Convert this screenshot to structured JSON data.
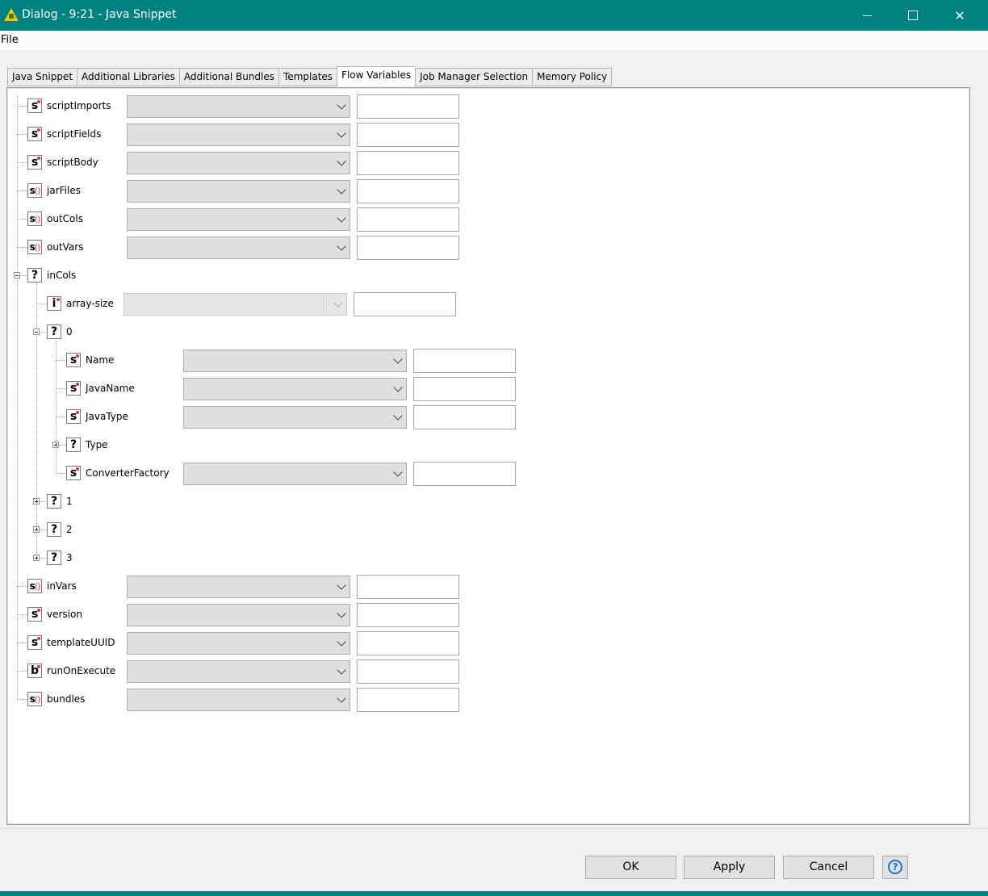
{
  "window": {
    "title": "Dialog - 9:21 - Java Snippet"
  },
  "menu": {
    "file": "File"
  },
  "tabs": [
    {
      "label": "Java Snippet",
      "active": false
    },
    {
      "label": "Additional Libraries",
      "active": false
    },
    {
      "label": "Additional Bundles",
      "active": false
    },
    {
      "label": "Templates",
      "active": false
    },
    {
      "label": "Flow Variables",
      "active": true
    },
    {
      "label": "Job Manager Selection",
      "active": false
    },
    {
      "label": "Memory Policy",
      "active": false
    }
  ],
  "tree": [
    {
      "label": "scriptImports",
      "type": "s",
      "icon": "string-icon"
    },
    {
      "label": "scriptFields",
      "type": "s",
      "icon": "string-icon"
    },
    {
      "label": "scriptBody",
      "type": "s",
      "icon": "string-icon"
    },
    {
      "label": "jarFiles",
      "type": "s()",
      "icon": "string-array-icon"
    },
    {
      "label": "outCols",
      "type": "s()",
      "icon": "string-array-icon"
    },
    {
      "label": "outVars",
      "type": "s()",
      "icon": "string-array-icon"
    },
    {
      "label": "inCols",
      "type": "?",
      "icon": "unknown-type-icon"
    },
    {
      "label": "array-size",
      "type": "i",
      "icon": "integer-icon"
    },
    {
      "label": "0",
      "type": "?",
      "icon": "unknown-type-icon"
    },
    {
      "label": "Name",
      "type": "s",
      "icon": "string-icon"
    },
    {
      "label": "JavaName",
      "type": "s",
      "icon": "string-icon"
    },
    {
      "label": "JavaType",
      "type": "s",
      "icon": "string-icon"
    },
    {
      "label": "Type",
      "type": "?",
      "icon": "unknown-type-icon"
    },
    {
      "label": "ConverterFactory",
      "type": "s",
      "icon": "string-icon"
    },
    {
      "label": "1",
      "type": "?",
      "icon": "unknown-type-icon"
    },
    {
      "label": "2",
      "type": "?",
      "icon": "unknown-type-icon"
    },
    {
      "label": "3",
      "type": "?",
      "icon": "unknown-type-icon"
    },
    {
      "label": "inVars",
      "type": "s()",
      "icon": "string-array-icon"
    },
    {
      "label": "version",
      "type": "s",
      "icon": "string-icon"
    },
    {
      "label": "templateUUID",
      "type": "s",
      "icon": "string-icon"
    },
    {
      "label": "runOnExecute",
      "type": "b",
      "icon": "boolean-icon"
    },
    {
      "label": "bundles",
      "type": "s()",
      "icon": "string-array-icon"
    }
  ],
  "buttons": {
    "ok": "OK",
    "apply": "Apply",
    "cancel": "Cancel",
    "help": "?"
  },
  "colors": {
    "titlebar": "#018282",
    "accent": "#1e73d6",
    "type_dot": "#d9343f"
  }
}
